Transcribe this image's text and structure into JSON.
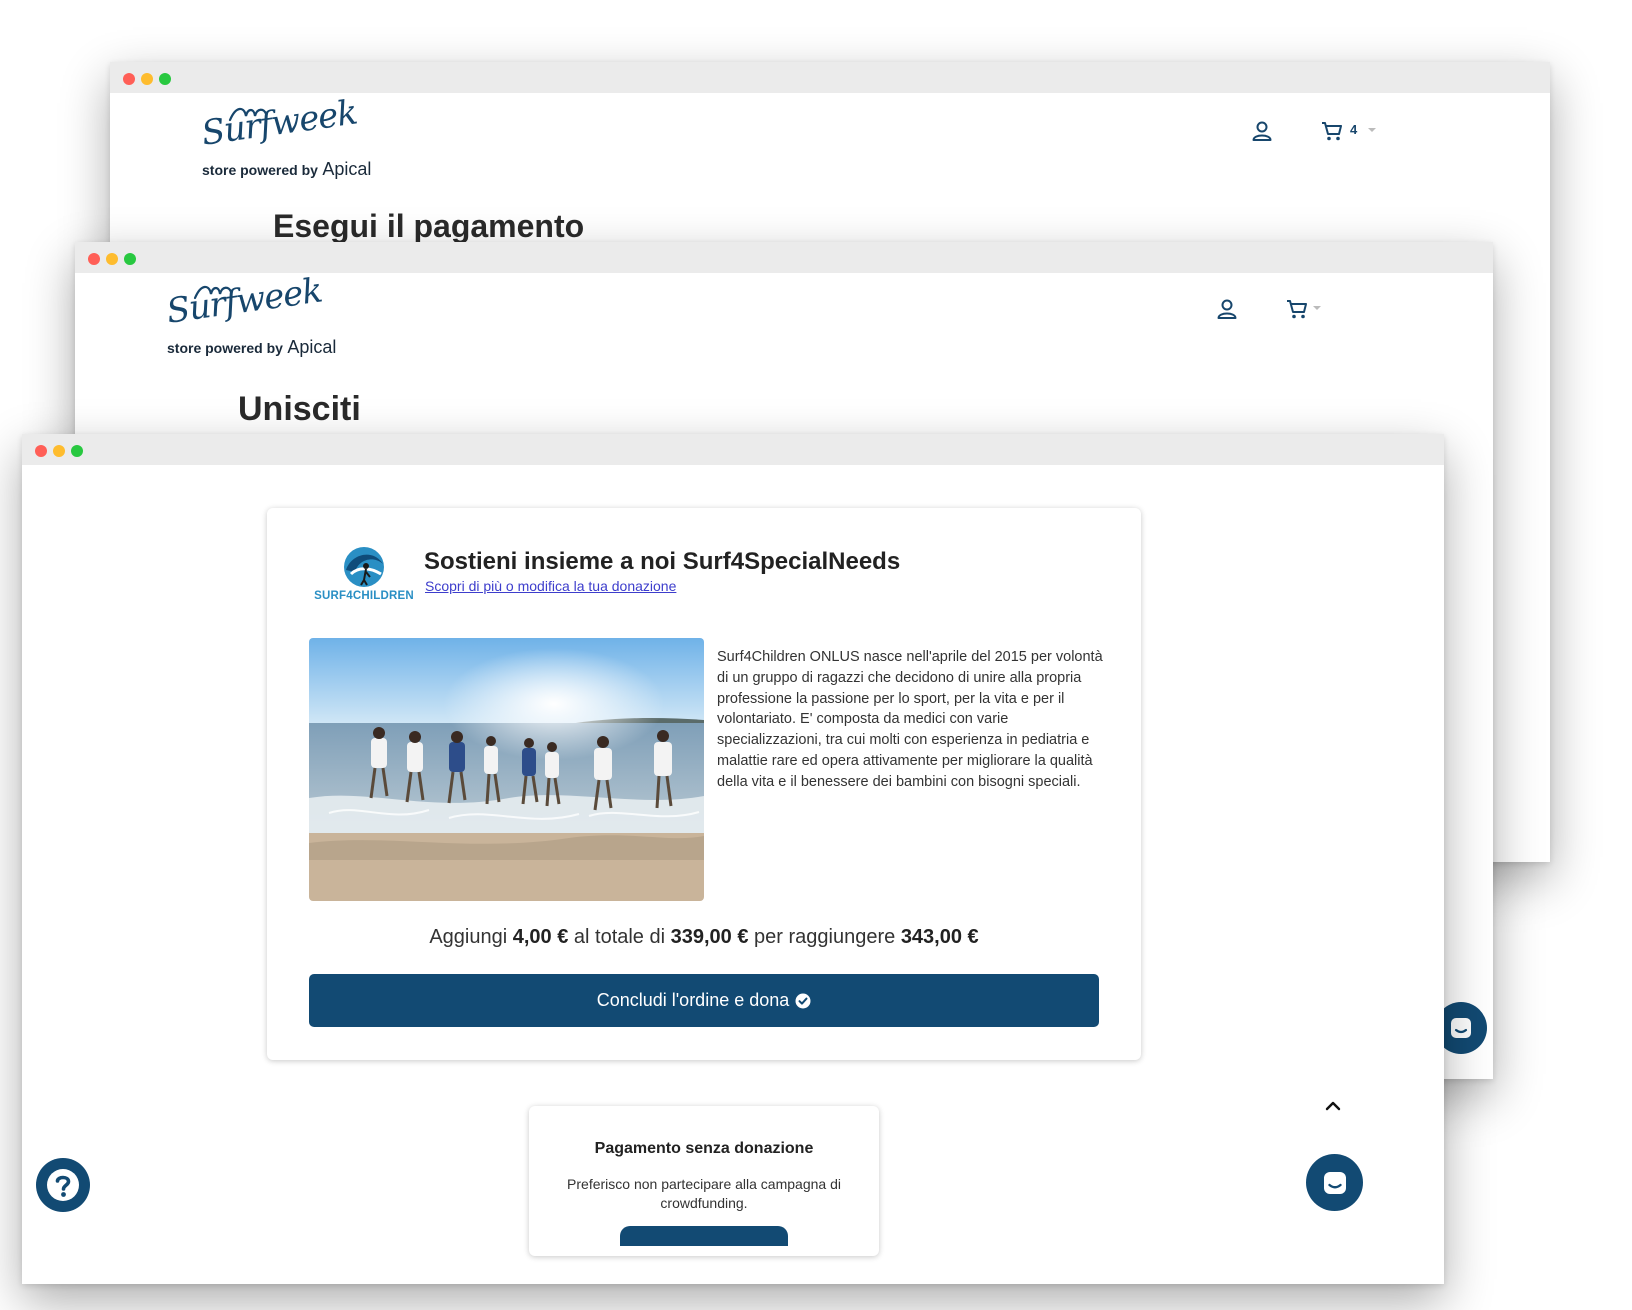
{
  "colors": {
    "brand": "#124a73",
    "link": "#3d3dcc",
    "titlebar": "#ebebeb"
  },
  "logo": {
    "script": "Surfweek",
    "tagline_prefix": "store powered by",
    "tagline_brand": "Apical"
  },
  "window_back": {
    "cart_count": "4",
    "heading": "Esegui il pagamento"
  },
  "window_mid": {
    "heading": "Unisciti"
  },
  "donation": {
    "org_logo": "SURF4CHILDREN",
    "title": "Sostieni insieme a noi Surf4SpecialNeeds",
    "link": "Scopri di più o modifica la tua donazione",
    "description": "Surf4Children ONLUS nasce nell'aprile del 2015 per volontà di un gruppo di ragazzi che decidono di unire alla propria professione la passione per lo sport, per la vita e per il volontariato. E' composta da medici con varie specializzazioni, tra cui molti con esperienza in pediatria e malattie rare ed opera attivamente per migliorare la qualità della vita e il benessere dei bambini con bisogni speciali.",
    "summary": {
      "t1": "Aggiungi ",
      "amount": "4,00 €",
      "t2": " al totale di ",
      "total": "339,00 €",
      "t3": " per raggiungere ",
      "new_total": "343,00 €"
    },
    "cta_label": "Concludi l'ordine e dona"
  },
  "no_donation": {
    "title": "Pagamento senza donazione",
    "text": "Preferisco non partecipare alla campagna di crowdfunding."
  },
  "icons": {
    "user": "user-icon",
    "cart": "cart-icon",
    "help": "question-mark-icon",
    "chat": "chat-icon",
    "scroll_top": "chevron-up-icon",
    "check": "check-circle-icon"
  }
}
